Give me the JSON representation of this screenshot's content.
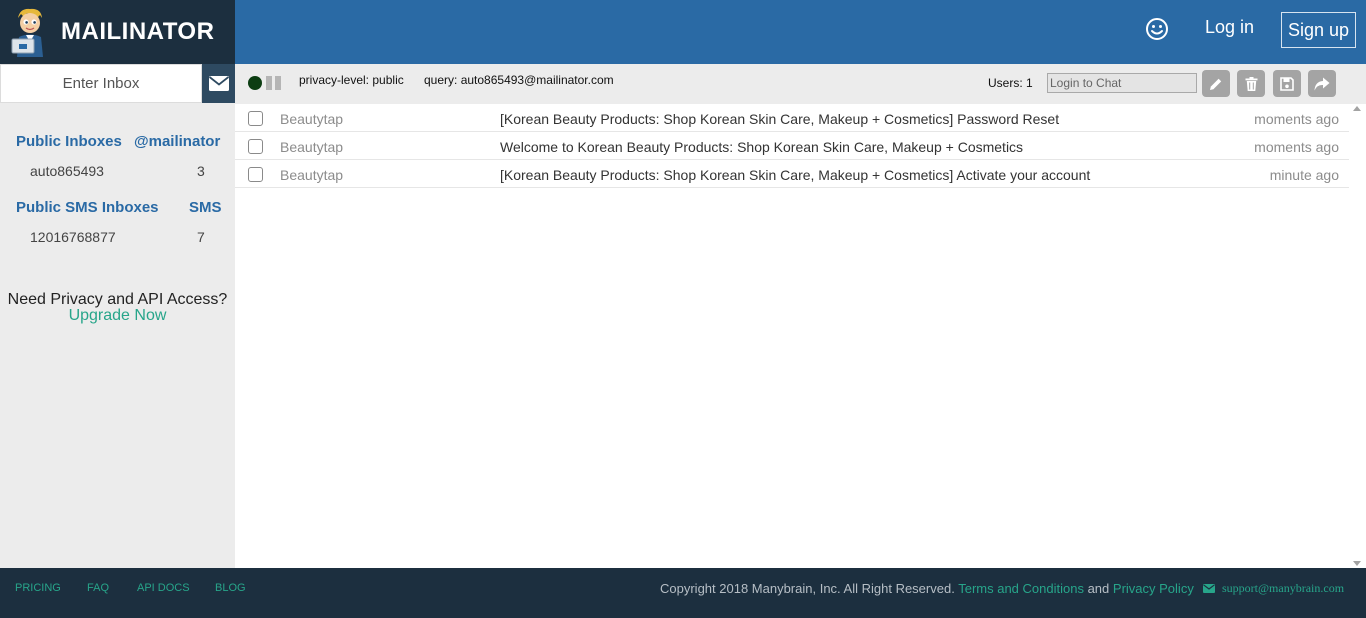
{
  "brand": {
    "name": "MAILINATOR",
    "mascot_icon": "mascot-icon"
  },
  "colors": {
    "header_blue": "#2a6aa5",
    "dark_navy": "#1c2f3f",
    "accent_green": "#27a58a",
    "sidebar_bg": "#ececec",
    "live_dot": "#0c3d12"
  },
  "header": {
    "smiley_icon": "smiley-icon",
    "login_label": "Log in",
    "signup_label": "Sign up"
  },
  "sidebar": {
    "inbox_placeholder": "Enter Inbox",
    "go_icon": "envelope-icon",
    "public_inboxes": {
      "title": "Public Inboxes",
      "domain": "@mailinator",
      "name": "auto865493",
      "count": "3"
    },
    "public_sms": {
      "title": "Public SMS Inboxes",
      "label": "SMS",
      "number": "12016768877",
      "count": "7"
    },
    "promo": {
      "text": "Need Privacy and API Access?",
      "link": "Upgrade Now"
    }
  },
  "toolbar": {
    "privacy_label": "privacy-level:",
    "privacy_value": "public",
    "query_label": "query:",
    "query_value": "auto865493@mailinator.com",
    "users_label": "Users:",
    "users_value": "1",
    "chat_placeholder": "Login to Chat",
    "buttons": [
      "pencil-icon",
      "trash-icon",
      "save-icon",
      "forward-icon"
    ]
  },
  "messages": [
    {
      "from": "Beautytap",
      "subject": "[Korean Beauty Products: Shop Korean Skin Care, Makeup + Cosmetics] Password Reset",
      "time": "moments ago"
    },
    {
      "from": "Beautytap",
      "subject": "Welcome to Korean Beauty Products: Shop Korean Skin Care, Makeup + Cosmetics",
      "time": "moments ago"
    },
    {
      "from": "Beautytap",
      "subject": "[Korean Beauty Products: Shop Korean Skin Care, Makeup + Cosmetics] Activate your account",
      "time": "minute ago"
    }
  ],
  "footer": {
    "links": [
      "PRICING",
      "FAQ",
      "API DOCS",
      "BLOG"
    ],
    "copyright_prefix": "Copyright 2018 Manybrain, Inc. All Right Reserved.",
    "terms": "Terms and Conditions",
    "and": "and",
    "privacy": "Privacy Policy",
    "support_email": "support@manybrain.com",
    "support_icon": "envelope-icon"
  }
}
